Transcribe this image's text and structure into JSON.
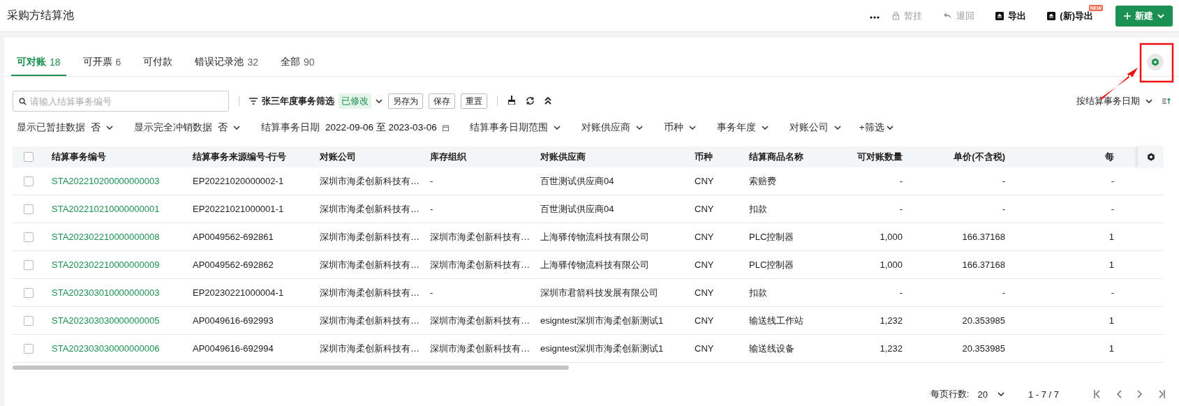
{
  "header": {
    "title": "采购方结算池",
    "actions": [
      {
        "label": "暂挂",
        "kind": "lock",
        "disabled": true
      },
      {
        "label": "退回",
        "kind": "undo",
        "disabled": true
      },
      {
        "label": "导出",
        "kind": "export",
        "disabled": false
      },
      {
        "label": "(新)导出",
        "kind": "export",
        "disabled": false,
        "badge": "NEW"
      }
    ],
    "primary": "新建"
  },
  "tabs": [
    {
      "label": "可对账",
      "count": "18",
      "selected": true
    },
    {
      "label": "可开票",
      "count": "6",
      "selected": false
    },
    {
      "label": "可付款",
      "selected": false
    },
    {
      "label": "错误记录池",
      "count": "32",
      "selected": false
    },
    {
      "label": "全部",
      "count": "90",
      "selected": false
    }
  ],
  "toolbar": {
    "search": {
      "placeholder": "请输入结算事务编号"
    },
    "view": {
      "name": "张三年度事务筛选",
      "tag": "已修改"
    },
    "buttons": [
      "另存为",
      "保存",
      "重置"
    ],
    "sort": "按结算事务日期"
  },
  "filters": [
    {
      "kind": "select",
      "label": "显示已暂挂数据",
      "value": "否"
    },
    {
      "kind": "select",
      "label": "显示完全冲销数据",
      "value": "否"
    },
    {
      "kind": "date_range",
      "label": "结算事务日期",
      "from": "2022-09-06",
      "separator": "至",
      "to": "2023-03-06"
    },
    {
      "kind": "select",
      "label": "结算事务日期范围"
    },
    {
      "kind": "select",
      "label": "对账供应商"
    },
    {
      "kind": "select",
      "label": "币种"
    },
    {
      "kind": "select",
      "label": "事务年度"
    },
    {
      "kind": "select",
      "label": "对账公司"
    },
    {
      "kind": "add",
      "label": "+筛选"
    }
  ],
  "table": {
    "select_all": {
      "checked": false
    },
    "columns": [
      {
        "label": "结算事务编号",
        "kind": "link"
      },
      {
        "label": "结算事务来源编号-行号",
        "kind": "text"
      },
      {
        "label": "对账公司",
        "kind": "text"
      },
      {
        "label": "库存组织",
        "kind": "text"
      },
      {
        "label": "对账供应商",
        "kind": "text"
      },
      {
        "label": "币种",
        "kind": "text"
      },
      {
        "label": "结算商品名称",
        "kind": "text"
      },
      {
        "label": "可对账数量",
        "kind": "number"
      },
      {
        "label": "单价(不含税)",
        "kind": "number"
      },
      {
        "label": "每",
        "kind": "number"
      }
    ],
    "rows": [
      {
        "checked": false,
        "cells": [
          "STA202210200000000003",
          "EP20221020000002-1",
          "深圳市海柔创新科技有…",
          "-",
          "百世测试供应商04",
          "CNY",
          "索赔费",
          "-",
          "-",
          "-"
        ]
      },
      {
        "checked": false,
        "cells": [
          "STA202210210000000001",
          "EP20221021000001-1",
          "深圳市海柔创新科技有…",
          "-",
          "百世测试供应商04",
          "CNY",
          "扣款",
          "-",
          "-",
          "-"
        ]
      },
      {
        "checked": false,
        "cells": [
          "STA202302210000000008",
          "AP0049562-692861",
          "深圳市海柔创新科技有…",
          "深圳市海柔创新科技有…",
          "上海驿传物流科技有限公司",
          "CNY",
          "PLC控制器",
          "1,000",
          "166.37168",
          "1"
        ]
      },
      {
        "checked": false,
        "cells": [
          "STA202302210000000009",
          "AP0049562-692862",
          "深圳市海柔创新科技有…",
          "深圳市海柔创新科技有…",
          "上海驿传物流科技有限公司",
          "CNY",
          "PLC控制器",
          "1,000",
          "166.37168",
          "1"
        ]
      },
      {
        "checked": false,
        "cells": [
          "STA202303010000000003",
          "EP20230221000004-1",
          "深圳市海柔创新科技有…",
          "-",
          "深圳市君箭科技发展有限公司",
          "CNY",
          "扣款",
          "-",
          "-",
          "-"
        ]
      },
      {
        "checked": false,
        "cells": [
          "STA202303030000000005",
          "AP0049616-692993",
          "深圳市海柔创新科技有…",
          "深圳市海柔创新科技有…",
          "esigntest深圳市海柔创新测试1",
          "CNY",
          "输送线工作站",
          "1,232",
          "20.353985",
          "1"
        ]
      },
      {
        "checked": false,
        "cells": [
          "STA202303030000000006",
          "AP0049616-692994",
          "深圳市海柔创新科技有…",
          "深圳市海柔创新科技有…",
          "esigntest深圳市海柔创新测试1",
          "CNY",
          "输送线设备",
          "1,232",
          "20.353985",
          "1"
        ]
      }
    ]
  },
  "pagination": {
    "rows_per_page_label": "每页行数:",
    "page_size": "20",
    "range": "1 - 7 / 7"
  }
}
